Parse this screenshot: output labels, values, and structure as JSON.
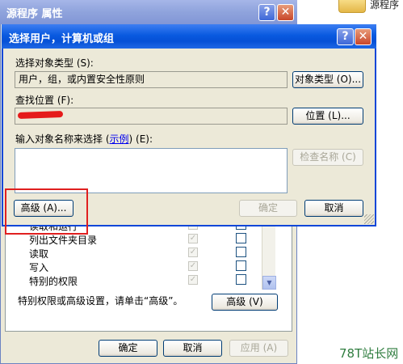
{
  "desktop": {
    "folder_label": "源程序"
  },
  "background_window": {
    "title": "源程序 属性",
    "permissions": [
      {
        "name": "读取和运行",
        "inherited": true,
        "deny": false
      },
      {
        "name": "列出文件夹目录",
        "inherited": true,
        "deny": false
      },
      {
        "name": "读取",
        "inherited": true,
        "deny": false
      },
      {
        "name": "写入",
        "inherited": true,
        "deny": false
      },
      {
        "name": "特别的权限",
        "inherited": true,
        "deny": false
      }
    ],
    "advanced_hint": "特别权限或高级设置，请单击“高级”。",
    "advanced_button": "高级 (V)",
    "ok_button": "确定",
    "cancel_button": "取消",
    "apply_button": "应用 (A)"
  },
  "dialog": {
    "title": "选择用户，计算机或组",
    "object_type_label": "选择对象类型 (S):",
    "object_type_value": "用户，组，或内置安全性原则",
    "object_type_button": "对象类型 (O)...",
    "location_label": "查找位置 (F):",
    "location_button": "位置 (L)...",
    "enter_names_label_prefix": "输入对象名称来选择 (",
    "enter_names_link": "示例",
    "enter_names_label_suffix": ") (E):",
    "names_value": "",
    "check_names_button": "检查名称 (C)",
    "advanced_button": "高级 (A)...",
    "ok_button": "确定",
    "cancel_button": "取消"
  },
  "watermark": "78T站长网",
  "colors": {
    "dialog_title_bar": "#0a5ae0",
    "inactive_title_bar": "#8fa3dc",
    "highlight_box": "#e02020",
    "watermark": "#2f7d3f"
  }
}
